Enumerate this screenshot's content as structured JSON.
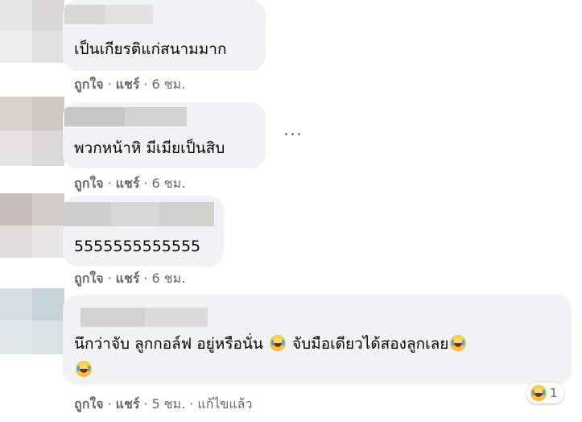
{
  "comments": [
    {
      "text": "เป็นเกียรติแก่สนามมาก",
      "actions": {
        "like": "ถูกใจ",
        "reply": "แชร์",
        "time": "6 ชม."
      }
    },
    {
      "text": "พวกหน้าหิ มีเมียเป็นสิบ",
      "actions": {
        "like": "ถูกใจ",
        "reply": "แชร์",
        "time": "6 ชม."
      }
    },
    {
      "text": "5555555555555",
      "actions": {
        "like": "ถูกใจ",
        "reply": "แชร์",
        "time": "6 ชม."
      }
    },
    {
      "text_a": "นึกว่าจับ ลูกกอล์ฟ อยู่หรือนั่น",
      "text_b": "จับมือเดียวได้สองลูกเลย",
      "actions": {
        "like": "ถูกใจ",
        "reply": "แชร์",
        "time": "5 ชม.",
        "edited": "แก้ไขแล้ว"
      },
      "reaction_count": "1"
    }
  ],
  "more_glyph": "...",
  "separator": "·",
  "icons": {
    "emoji": "rolling-on-floor-laughing",
    "more": "more-options"
  }
}
